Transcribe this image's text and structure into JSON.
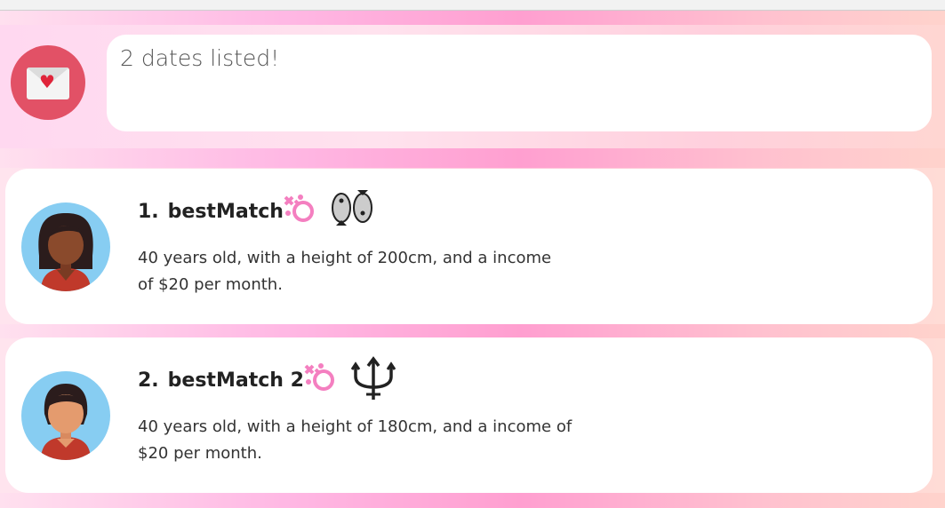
{
  "result": {
    "message": "2 dates listed!",
    "icon": "envelope-heart-icon"
  },
  "dates": [
    {
      "index": "1.",
      "name": "bestMatch",
      "gender_icon": "female-gender-icon",
      "zodiac_icon": "pisces-icon",
      "description_line1": "40 years old, with a height of 200cm, and a income",
      "description_line2": "of $20 per month.",
      "avatar_icon": "woman-long-hair-avatar-icon"
    },
    {
      "index": "2.",
      "name": "bestMatch 2",
      "gender_icon": "female-gender-icon",
      "zodiac_icon": "trident-icon",
      "description_line1": "40 years old, with a height of 180cm, and a income of",
      "description_line2": "$20 per month.",
      "avatar_icon": "woman-short-hair-avatar-icon"
    }
  ],
  "colors": {
    "accent_pink": "#f47fc0",
    "mail_red": "#e25166",
    "avatar_bg": "#87cdf2"
  }
}
